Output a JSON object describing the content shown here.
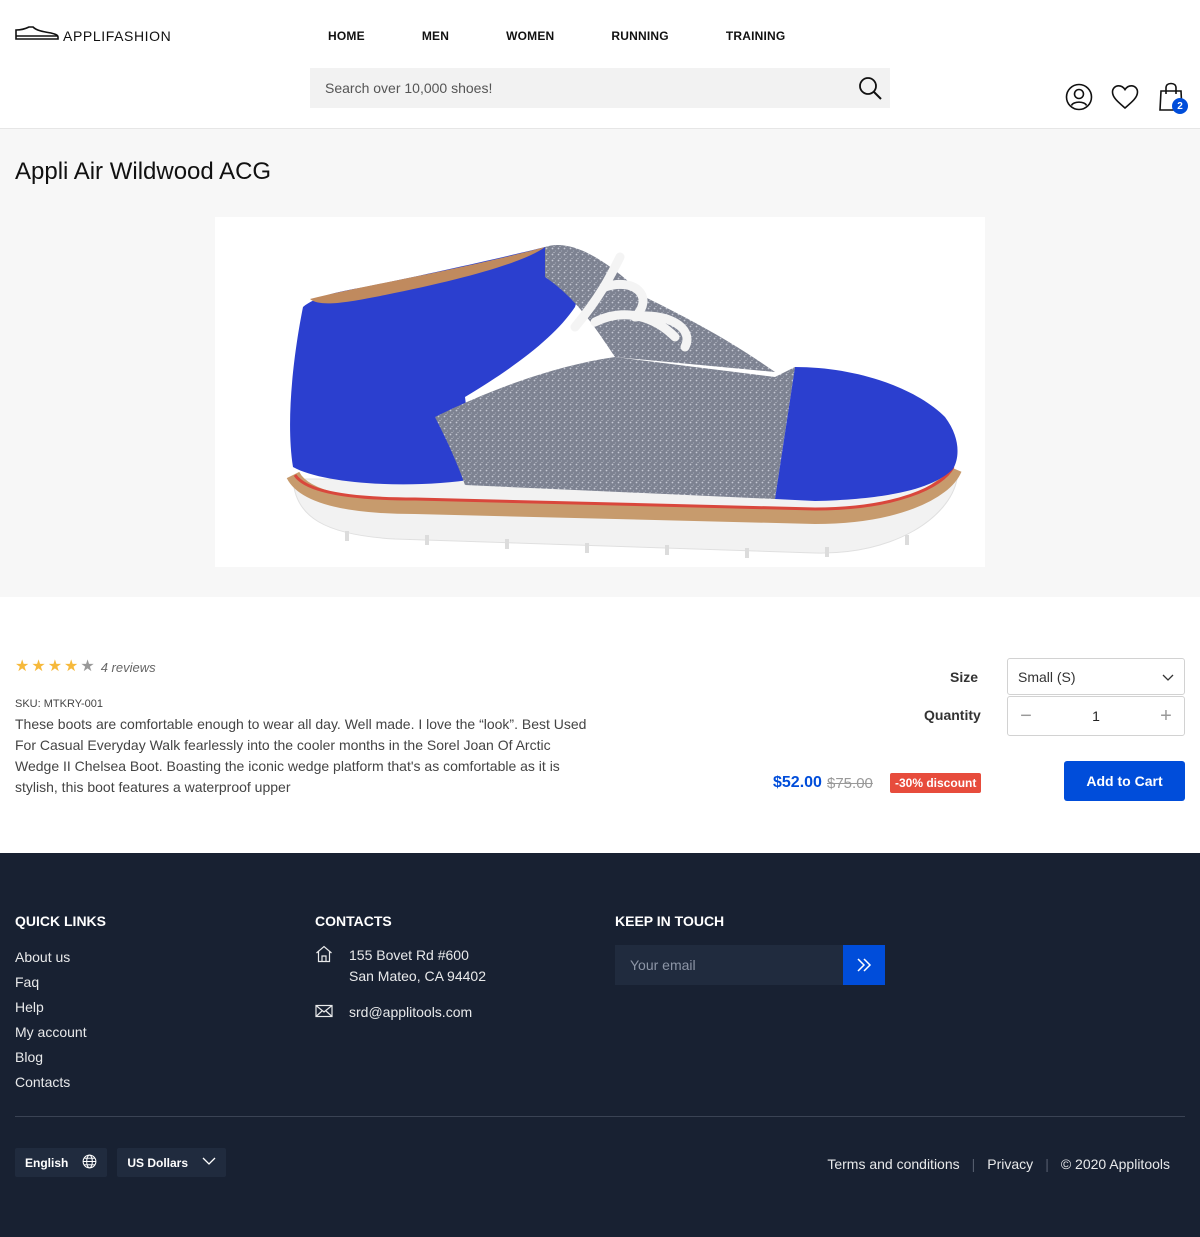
{
  "brand": {
    "name": "APPLIFASHION"
  },
  "nav": [
    "HOME",
    "MEN",
    "WOMEN",
    "RUNNING",
    "TRAINING"
  ],
  "search": {
    "placeholder": "Search over 10,000 shoes!"
  },
  "cart": {
    "count": "2"
  },
  "product": {
    "title": "Appli Air Wildwood ACG",
    "rating": 4,
    "rating_max": 5,
    "reviews": "4 reviews",
    "sku": "SKU: MTKRY-001",
    "description": "These boots are comfortable enough to wear all day. Well made. I love the “look”. Best Used For Casual Everyday Walk fearlessly into the cooler months in the Sorel Joan Of Arctic Wedge II Chelsea Boot. Boasting the iconic wedge platform that's as comfortable as it is stylish, this boot features a waterproof upper",
    "size_label": "Size",
    "size_value": "Small (S)",
    "quantity_label": "Quantity",
    "quantity": "1",
    "qty_minus": "−",
    "qty_plus": "+",
    "price_new": "$52.00",
    "price_old": "$75.00",
    "discount": "-30% discount",
    "add_to_cart": "Add to Cart",
    "colors": {
      "upper": "#2b3fcf",
      "accent": "#004dda"
    }
  },
  "footer": {
    "quick_links_title": "QUICK LINKS",
    "quick_links": [
      "About us",
      "Faq",
      "Help",
      "My account",
      "Blog",
      "Contacts"
    ],
    "contacts_title": "CONTACTS",
    "address_line1": "155 Bovet Rd #600",
    "address_line2": "San Mateo, CA 94402",
    "email": "srd@applitools.com",
    "keep_title": "KEEP IN TOUCH",
    "email_placeholder": "Your email",
    "language": "English",
    "currency": "US Dollars",
    "terms": "Terms and conditions",
    "privacy": "Privacy",
    "copyright": "© 2020 Applitools",
    "separator": "|"
  }
}
